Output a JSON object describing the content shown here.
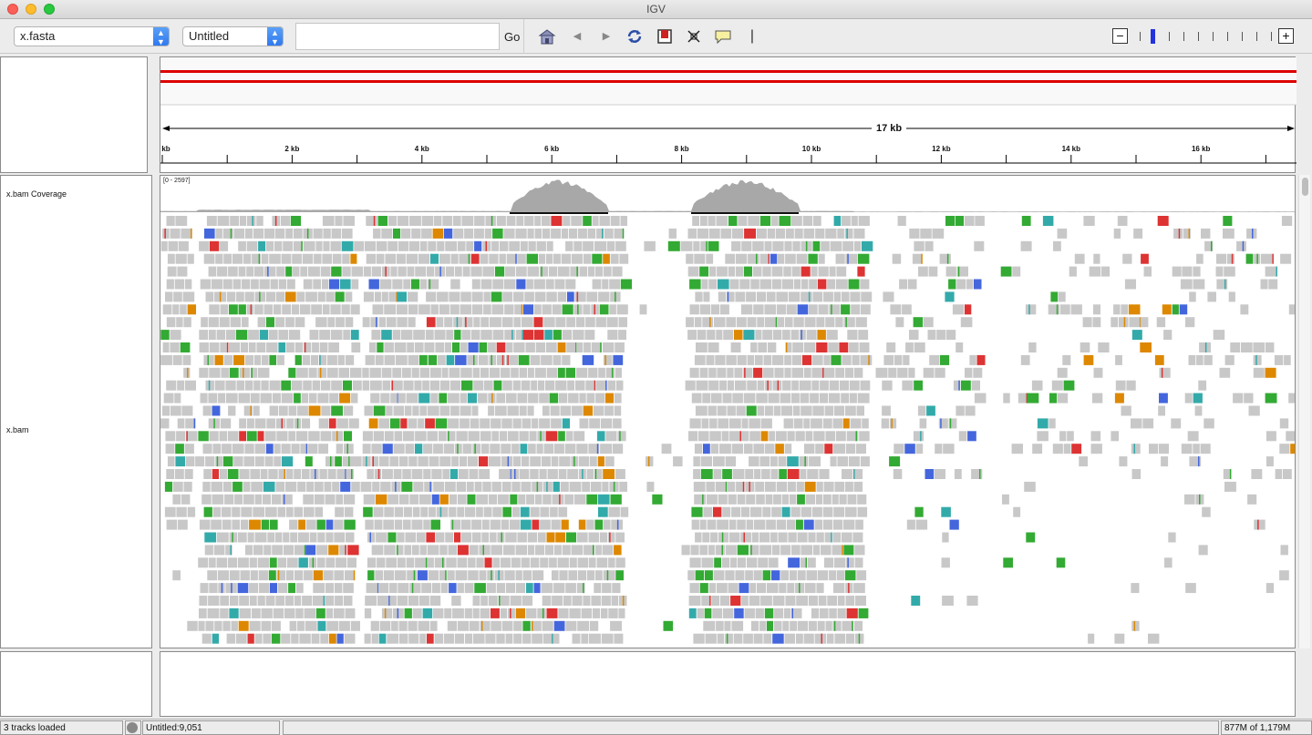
{
  "window": {
    "title": "IGV"
  },
  "toolbar": {
    "genome": "x.fasta",
    "session": "Untitled",
    "locus_value": "",
    "go_label": "Go",
    "icons": [
      "home-icon",
      "back-icon",
      "forward-icon",
      "refresh-icon",
      "region-of-interest-icon",
      "resize-icon",
      "popup-text-icon"
    ]
  },
  "ruler": {
    "span_label": "17 kb",
    "ticks": [
      {
        "label": "kb",
        "kb": 0
      },
      {
        "label": "2 kb",
        "kb": 2
      },
      {
        "label": "4 kb",
        "kb": 4
      },
      {
        "label": "6 kb",
        "kb": 6
      },
      {
        "label": "8 kb",
        "kb": 8
      },
      {
        "label": "10 kb",
        "kb": 10
      },
      {
        "label": "12 kb",
        "kb": 12
      },
      {
        "label": "14 kb",
        "kb": 14
      },
      {
        "label": "16 kb",
        "kb": 16
      }
    ],
    "range_kb": [
      0,
      17.5
    ]
  },
  "tracks": {
    "coverage_name": "x.bam Coverage",
    "coverage_range": "[0 - 2597]",
    "alignment_name": "x.bam"
  },
  "status": {
    "tracks_loaded": "3 tracks loaded",
    "position": "Untitled:9,051",
    "message": "",
    "memory": "877M of 1,179M"
  },
  "colors": {
    "read": "#c8c8c8",
    "mismatch_a": "#33aa33",
    "mismatch_c": "#4466dd",
    "mismatch_g": "#dd8800",
    "mismatch_t": "#dd3333",
    "cyan": "#33aaaa",
    "coverage": "#a8a8a8",
    "chrom_bar": "#dd0000"
  }
}
